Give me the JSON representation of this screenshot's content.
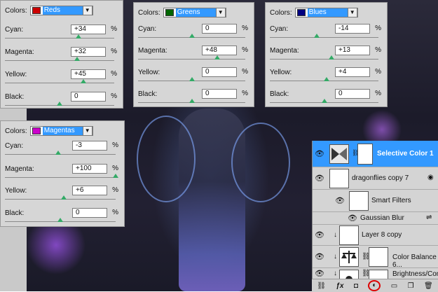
{
  "panels": [
    {
      "id": "reds",
      "colors_label": "Colors:",
      "selected": "Reds",
      "swatch": "#cc0000",
      "sliders": [
        {
          "label": "Cyan:",
          "value": "+34",
          "unit": "%",
          "level": 0.67
        },
        {
          "label": "Magenta:",
          "value": "+32",
          "unit": "%",
          "level": 0.66
        },
        {
          "label": "Yellow:",
          "value": "+45",
          "unit": "%",
          "level": 0.72
        },
        {
          "label": "Black:",
          "value": "0",
          "unit": "%",
          "level": 0.5
        }
      ]
    },
    {
      "id": "greens",
      "colors_label": "Colors:",
      "selected": "Greens",
      "swatch": "#006600",
      "sliders": [
        {
          "label": "Cyan:",
          "value": "0",
          "unit": "%",
          "level": 0.5
        },
        {
          "label": "Magenta:",
          "value": "+48",
          "unit": "%",
          "level": 0.74
        },
        {
          "label": "Yellow:",
          "value": "0",
          "unit": "%",
          "level": 0.5
        },
        {
          "label": "Black:",
          "value": "0",
          "unit": "%",
          "level": 0.5
        }
      ]
    },
    {
      "id": "blues",
      "colors_label": "Colors:",
      "selected": "Blues",
      "swatch": "#000080",
      "sliders": [
        {
          "label": "Cyan:",
          "value": "-14",
          "unit": "%",
          "level": 0.43
        },
        {
          "label": "Magenta:",
          "value": "+13",
          "unit": "%",
          "level": 0.57
        },
        {
          "label": "Yellow:",
          "value": "+4",
          "unit": "%",
          "level": 0.52
        },
        {
          "label": "Black:",
          "value": "0",
          "unit": "%",
          "level": 0.5
        }
      ]
    },
    {
      "id": "magentas",
      "colors_label": "Colors:",
      "selected": "Magentas",
      "swatch": "#cc00cc",
      "sliders": [
        {
          "label": "Cyan:",
          "value": "-3",
          "unit": "%",
          "level": 0.48
        },
        {
          "label": "Magenta:",
          "value": "+100",
          "unit": "%",
          "level": 1.0
        },
        {
          "label": "Yellow:",
          "value": "+6",
          "unit": "%",
          "level": 0.53
        },
        {
          "label": "Black:",
          "value": "0",
          "unit": "%",
          "level": 0.5
        }
      ]
    }
  ],
  "accent": "#3399ff",
  "layers": {
    "selective_color": "Selective Color 1",
    "dragonflies": "dragonflies copy 7",
    "smart_filters": "Smart Filters",
    "gaussian_blur": "Gaussian Blur",
    "layer8": "Layer 8 copy",
    "color_balance": "Color Balance 6...",
    "brightness": "Brightness/Con..."
  }
}
